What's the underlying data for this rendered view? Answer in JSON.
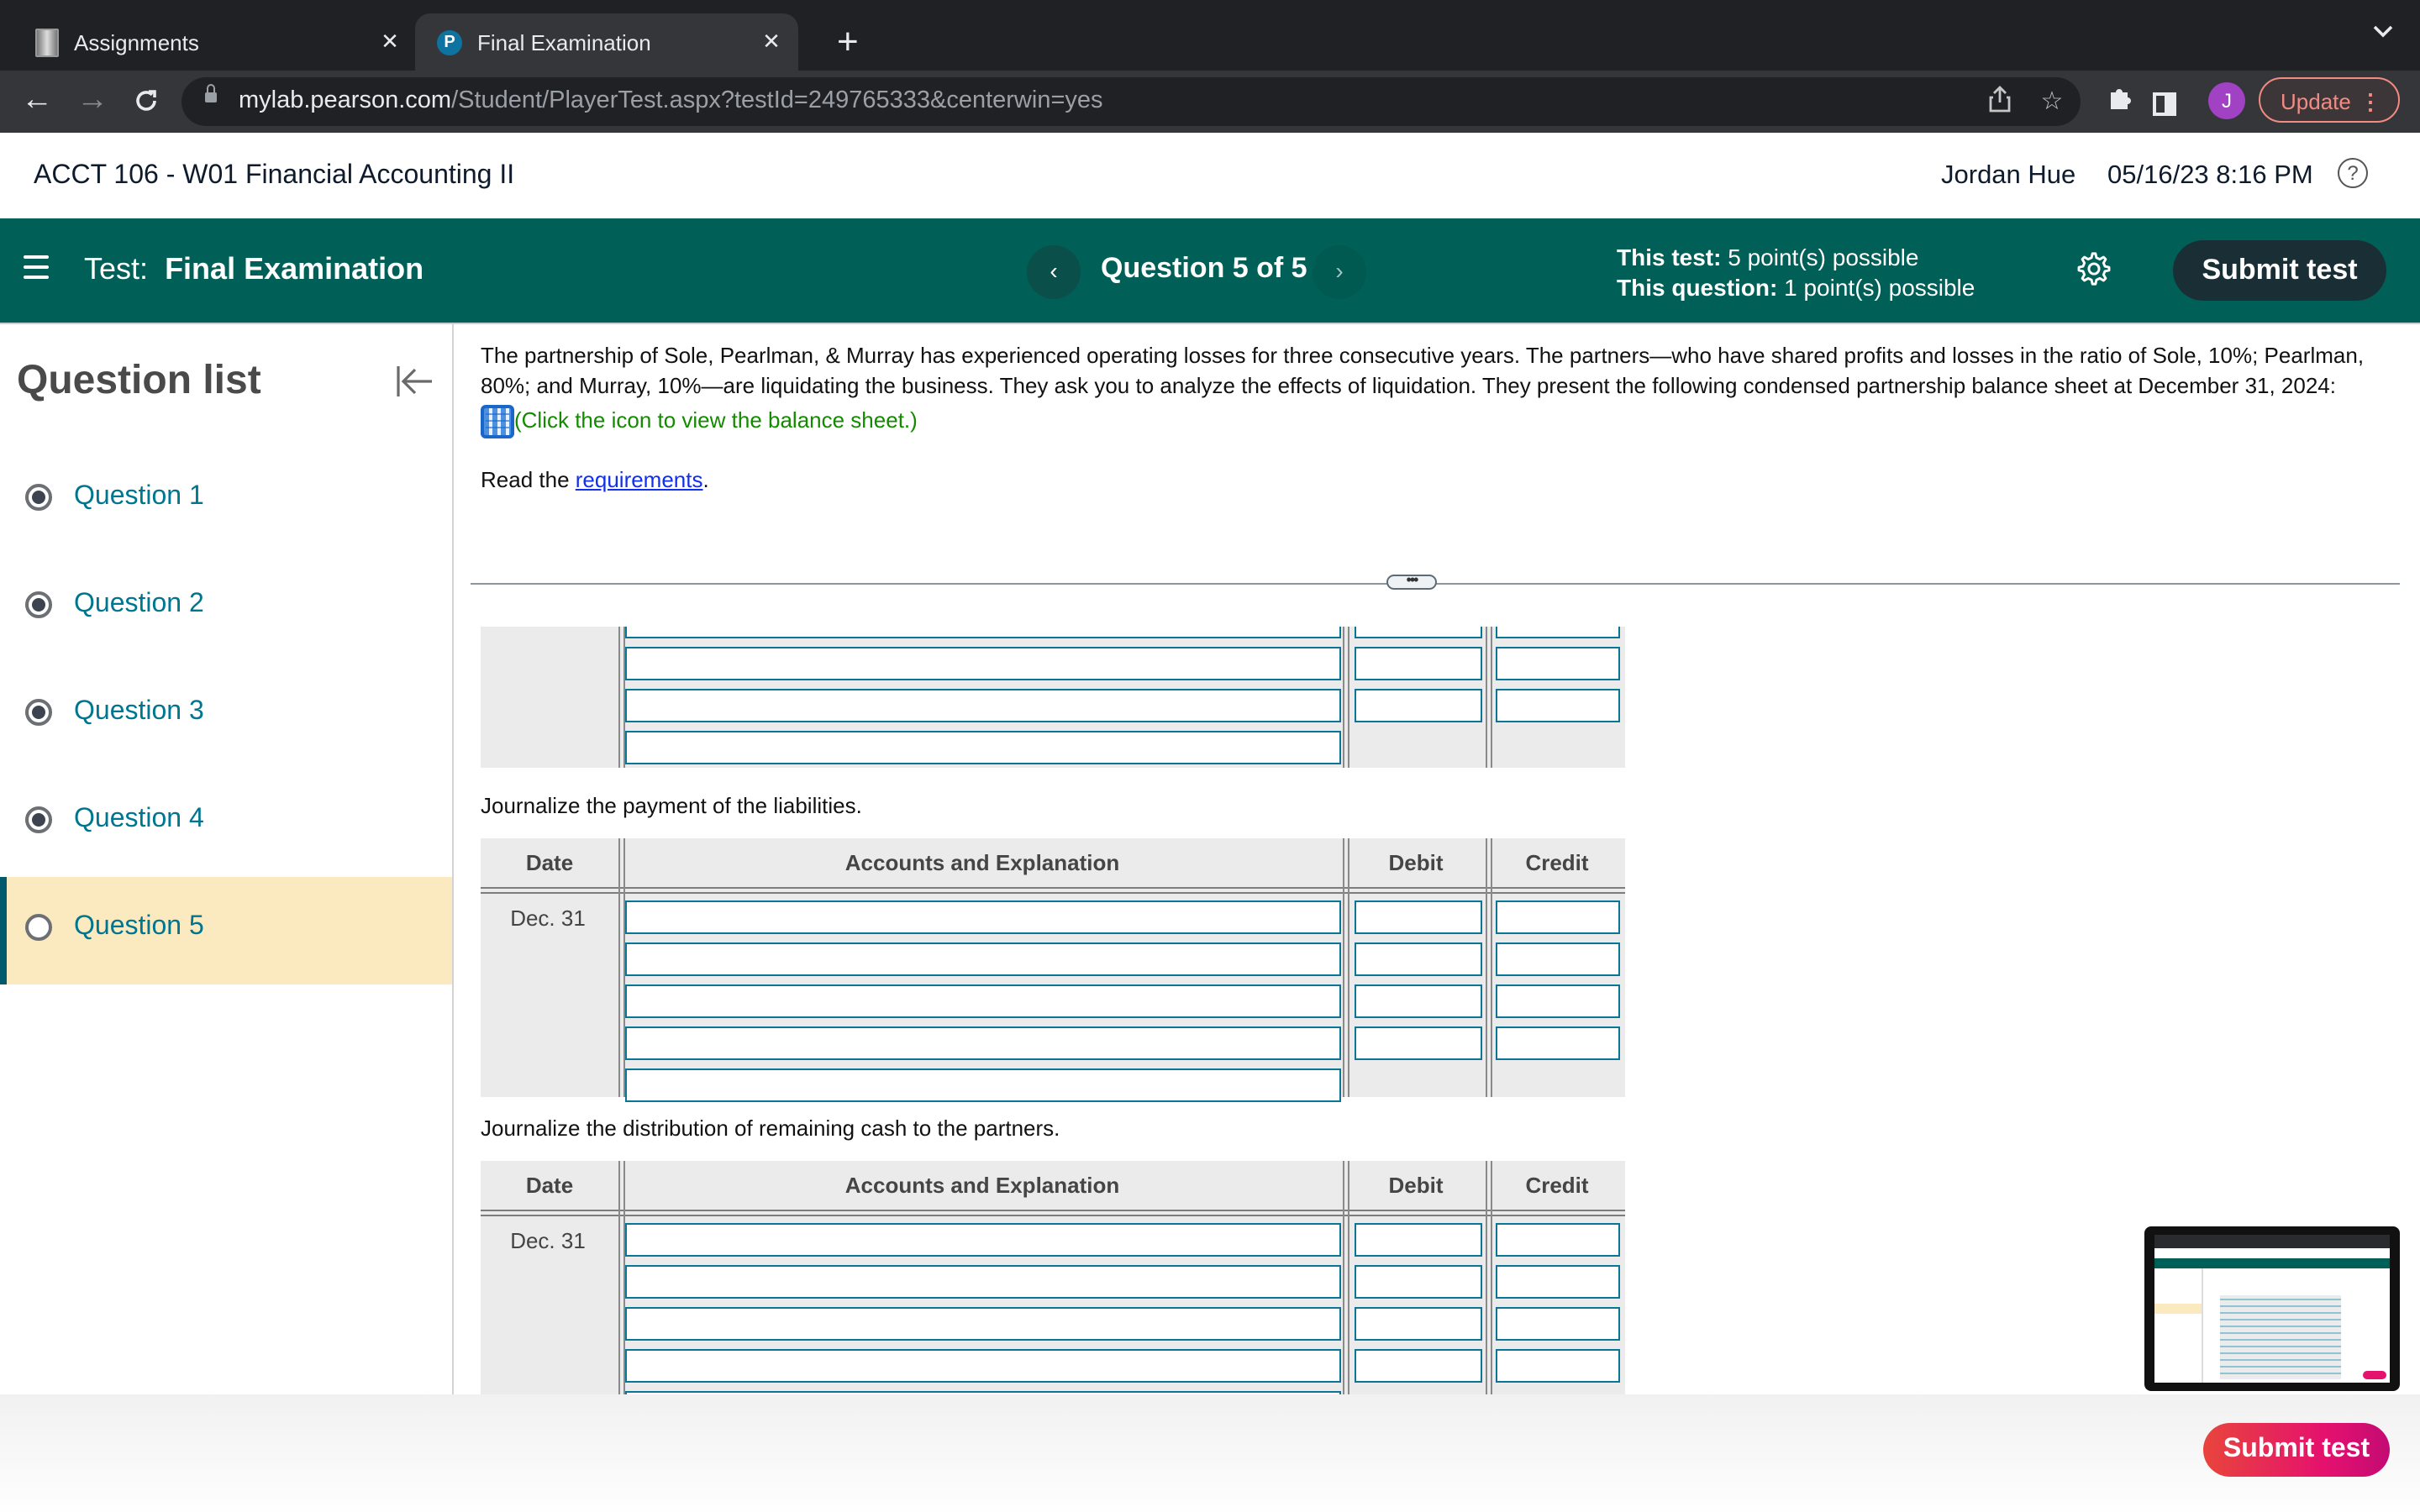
{
  "browser": {
    "tabs": [
      {
        "title": "Assignments",
        "active": false
      },
      {
        "title": "Final Examination",
        "active": true
      }
    ],
    "url_host": "mylab.pearson.com",
    "url_path": "/Student/PlayerTest.aspx?testId=249765333&centerwin=yes",
    "profile_initial": "J",
    "update_label": "Update",
    "icons": {
      "back": "←",
      "forward": "→",
      "reload": "C",
      "share": "⇪",
      "star": "☆",
      "extensions": "✦",
      "new_tab": "+",
      "close": "✕",
      "dropdown": "⌄",
      "more": "⋮",
      "favicon_pearson": "P"
    }
  },
  "course": {
    "title": "ACCT 106 - W01 Financial Accounting II",
    "user": "Jordan Hue",
    "datetime": "05/16/23 8:16 PM",
    "help_icon": "?"
  },
  "testbar": {
    "test_prefix": "Test:",
    "test_name": "Final Examination",
    "question_position": "Question 5 of 5",
    "prev_icon": "‹",
    "next_icon": "›",
    "this_test_label": "This test:",
    "this_test_value": "5 point(s) possible",
    "this_question_label": "This question:",
    "this_question_value": "1 point(s) possible",
    "submit_label": "Submit test"
  },
  "sidebar": {
    "title": "Question list",
    "collapse_icon": "|←",
    "items": [
      {
        "label": "Question 1",
        "answered": true,
        "current": false
      },
      {
        "label": "Question 2",
        "answered": true,
        "current": false
      },
      {
        "label": "Question 3",
        "answered": true,
        "current": false
      },
      {
        "label": "Question 4",
        "answered": true,
        "current": false
      },
      {
        "label": "Question 5",
        "answered": false,
        "current": true
      }
    ]
  },
  "question": {
    "text": "The partnership of Sole, Pearlman, & Murray has experienced operating losses for three consecutive years. The partners—who have shared profits and losses in the ratio of Sole, 10%; Pearlman, 80%; and Murray, 10%—are liquidating the business. They ask you to analyze the effects of liquidation. They present the following condensed partnership balance sheet at December 31, 2024:",
    "balance_sheet_link": "(Click the icon to view the balance sheet.)",
    "read_prefix": "Read the ",
    "requirements_link": "requirements",
    "read_suffix": ".",
    "divider_handle": "•••"
  },
  "journal": {
    "headers": {
      "date": "Date",
      "accounts": "Accounts and Explanation",
      "debit": "Debit",
      "credit": "Credit"
    },
    "partial_table": {
      "account_rows": 3,
      "amount_rows": 2
    },
    "tables": [
      {
        "instruction": "Journalize the payment of the liabilities.",
        "date": "Dec. 31",
        "account_rows": 5,
        "amount_rows": 4
      },
      {
        "instruction": "Journalize the distribution of remaining cash to the partners.",
        "date": "Dec. 31",
        "account_rows": 5,
        "amount_rows": 4
      }
    ]
  },
  "footer": {
    "submit_label": "Submit test"
  },
  "colors": {
    "teal_bar": "#005f57",
    "link_teal": "#007590",
    "current_question_bg": "#fbe9bf",
    "input_border": "#0b7596",
    "submit_gradient_start": "#e8453c",
    "submit_gradient_end": "#c30b73"
  }
}
